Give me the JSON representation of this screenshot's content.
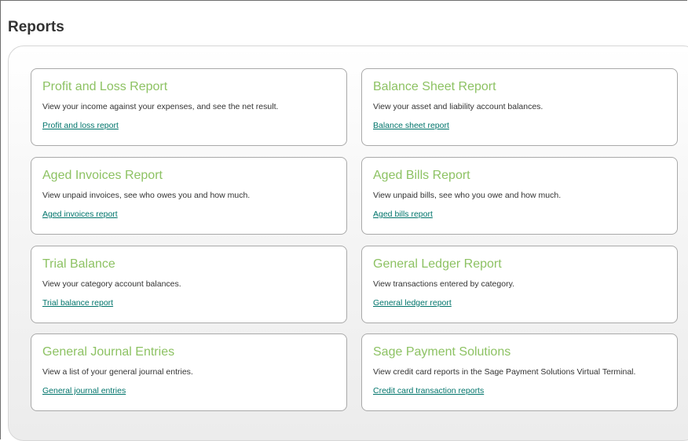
{
  "page": {
    "title": "Reports"
  },
  "reports": [
    {
      "title": "Profit and Loss Report",
      "description": "View your income against your expenses, and see the net result.",
      "link": "Profit and loss report"
    },
    {
      "title": "Balance Sheet Report",
      "description": "View your asset and liability account balances.",
      "link": "Balance sheet report"
    },
    {
      "title": "Aged Invoices Report",
      "description": "View unpaid invoices, see who owes you and how much.",
      "link": "Aged invoices report"
    },
    {
      "title": "Aged Bills Report",
      "description": "View unpaid bills, see who you owe and how much.",
      "link": "Aged bills report"
    },
    {
      "title": "Trial Balance",
      "description": "View your category account balances.",
      "link": "Trial balance report"
    },
    {
      "title": "General Ledger Report",
      "description": "View transactions entered by category.",
      "link": "General ledger report"
    },
    {
      "title": "General Journal Entries",
      "description": "View a list of your general journal entries.",
      "link": "General journal entries"
    },
    {
      "title": "Sage Payment Solutions",
      "description": "View credit card reports in the Sage Payment Solutions Virtual Terminal.",
      "link": "Credit card transaction reports"
    }
  ],
  "colors": {
    "card_title": "#8dc263",
    "link": "#00746b",
    "text": "#333333"
  }
}
